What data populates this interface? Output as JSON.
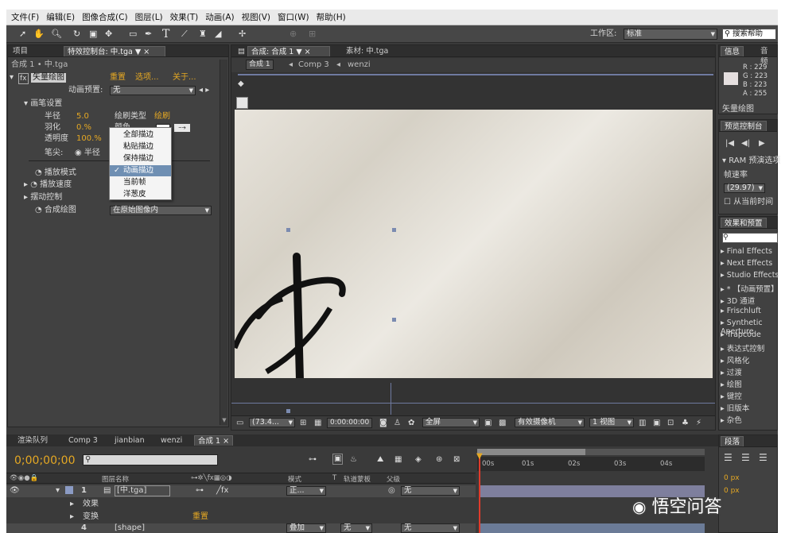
{
  "menu": [
    "文件(F)",
    "编辑(E)",
    "图像合成(C)",
    "图层(L)",
    "效果(T)",
    "动画(A)",
    "视图(V)",
    "窗口(W)",
    "帮助(H)"
  ],
  "toolbar": {
    "workspace_label": "工作区:",
    "workspace_value": "标准",
    "search_help": "搜索帮助"
  },
  "left_panel": {
    "tab1": "项目",
    "tab2": "特效控制台: 中.tga",
    "header": "合成 1 • 中.tga",
    "effect_name": "矢量绘图",
    "reset": "重置",
    "options": "选项...",
    "about": "关于...",
    "anim_preset_label": "动画预置:",
    "anim_preset_value": "无",
    "brush_settings": "画笔设置",
    "radius_label": "半径",
    "radius_value": "5.0",
    "feather_label": "羽化",
    "feather_value": "0.%",
    "opacity_label": "透明度",
    "opacity_value": "100.%",
    "brush_type_label": "绘刷类型",
    "brush_type_value": "绘刷",
    "color_label": "颜色",
    "pen_tip_label": "笔尖:",
    "pen_tip_value": "半径",
    "playback_mode": "播放模式",
    "playback_speed": "播放速度",
    "shake_control": "摆动控制",
    "composite_label": "合成绘图",
    "composite_value": "在原始图像内"
  },
  "context_menu": {
    "items": [
      "全部描边",
      "粘贴描边",
      "保持描边",
      "动画描边",
      "当前帧",
      "洋葱皮"
    ],
    "selected_index": 3
  },
  "comp_panel": {
    "tab": "合成: 合成 1",
    "tab_footage": "素材: 中.tga",
    "crumbs": [
      "合成 1",
      "Comp 3",
      "wenzi"
    ],
    "zoom": "(73.4...",
    "timecode": "0:00:00:00",
    "resolution": "全屏",
    "camera": "有效摄像机",
    "views": "1 视图"
  },
  "info_panel": {
    "tab": "信息",
    "tab2": "音频",
    "r": "R : 229",
    "g": "G : 223",
    "b": "B : 223",
    "a": "A : 255",
    "footer": "矢量绘图"
  },
  "preview_panel": {
    "tab": "预览控制台",
    "ram": "RAM 预演选项",
    "fps_label": "帧速率",
    "fps_value": "(29.97)",
    "from_current": "从当前时间"
  },
  "effects_panel": {
    "tab": "效果和预置",
    "items": [
      "Final Effects",
      "Next Effects",
      "Studio Effects",
      "* 【动画预置】",
      "3D 通道",
      "Frischluft",
      "Synthetic Aperture",
      "Trapcode",
      "表达式控制",
      "风格化",
      "过渡",
      "绘图",
      "键控",
      "旧版本",
      "杂色"
    ]
  },
  "paragraph_panel": {
    "tab": "段落",
    "indent1": "0 px",
    "indent2": "0 px"
  },
  "timeline": {
    "tabs": [
      "渲染队列",
      "Comp 3",
      "jianbian",
      "wenzi",
      "合成 1"
    ],
    "timecode": "0;00;00;00",
    "col_headers": [
      "图层名称",
      "模式",
      "T",
      "轨道蒙板",
      "父级"
    ],
    "ruler": [
      "00s",
      "01s",
      "02s",
      "03s",
      "04s"
    ],
    "layers": [
      {
        "num": "1",
        "name": "[中.tga]",
        "mode": "正...",
        "parent": "无"
      },
      {
        "num": "",
        "name": "效果",
        "mode": "",
        "parent": ""
      },
      {
        "num": "",
        "name": "变换",
        "mode": "",
        "parent": ""
      },
      {
        "num": "4",
        "name": "[shape]",
        "mode": "叠加",
        "track": "无",
        "parent": "无"
      }
    ],
    "reset": "重置"
  },
  "watermark": "悟空问答"
}
